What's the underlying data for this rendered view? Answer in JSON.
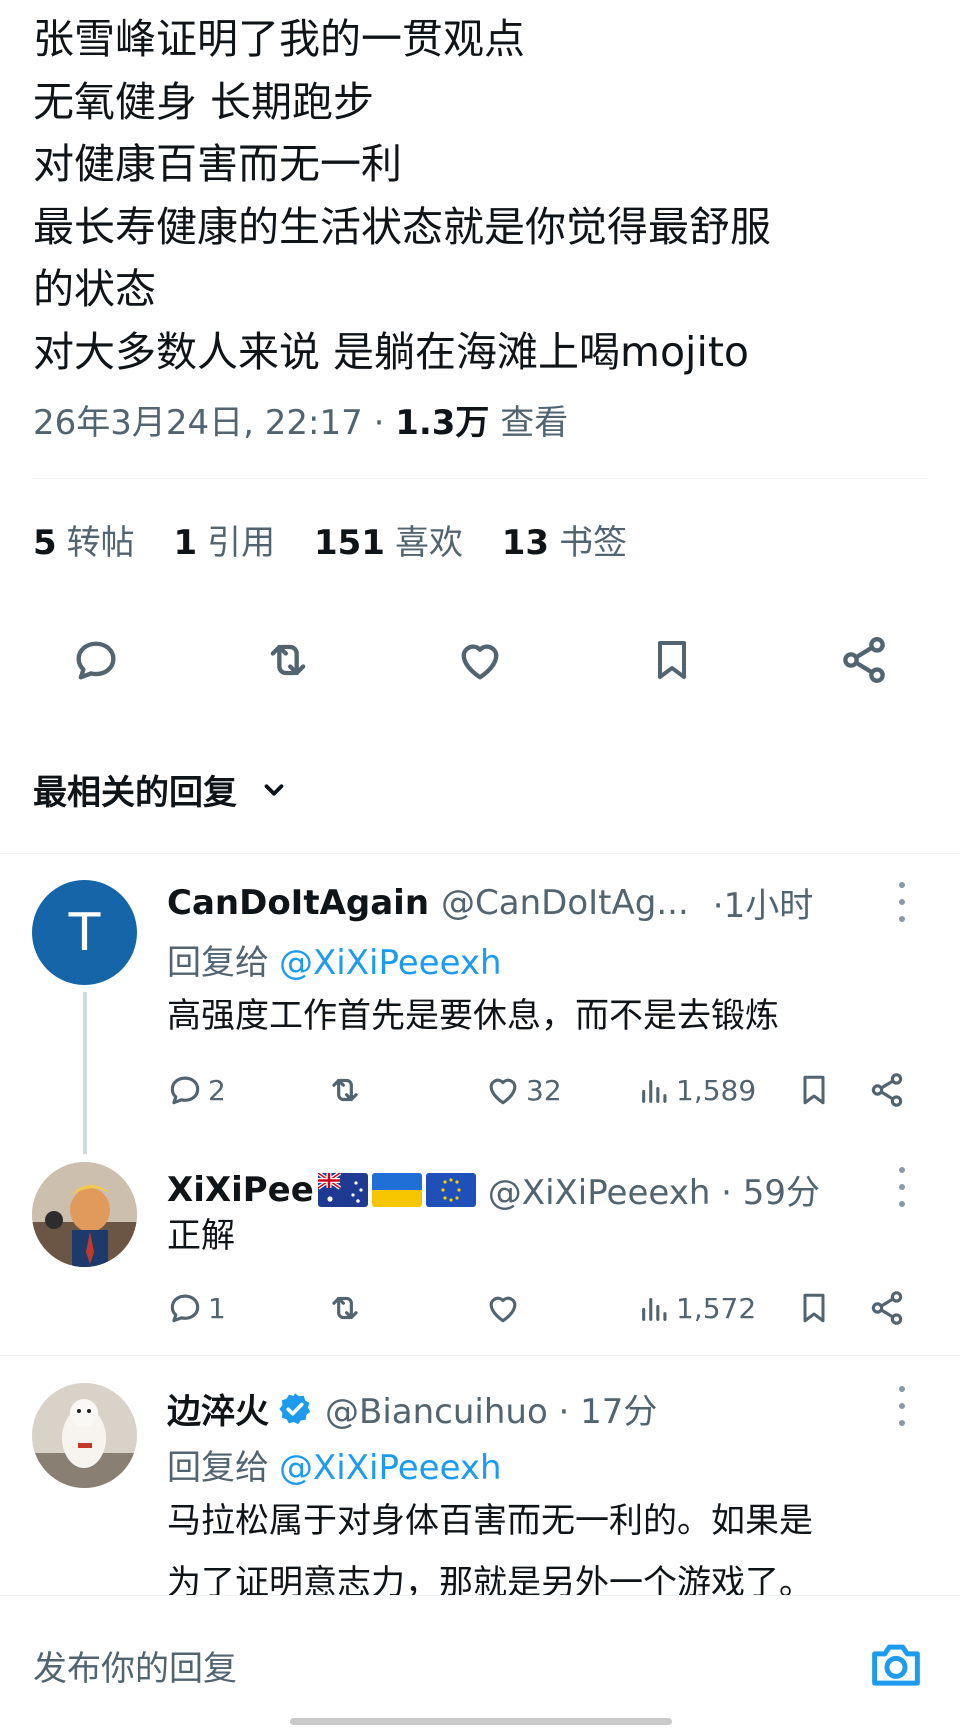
{
  "tweet": {
    "lines": [
      "张雪峰证明了我的一贯观点",
      "无氧健身 长期跑步",
      "对健康百害而无一利",
      "最长寿健康的生活状态就是你觉得最舒服",
      "的状态",
      "对大多数人来说 是躺在海滩上喝mojito"
    ],
    "timestamp": "26年3月24日, 22:17 ·",
    "views_count": "1.3万",
    "views_label": "查看"
  },
  "stats": [
    {
      "count": "5",
      "label": "转帖"
    },
    {
      "count": "1",
      "label": "引用"
    },
    {
      "count": "151",
      "label": "喜欢"
    },
    {
      "count": "13",
      "label": "书签"
    }
  ],
  "actions": {
    "icons": [
      "reply-icon",
      "repost-icon",
      "like-icon",
      "bookmark-icon",
      "share-icon"
    ]
  },
  "sort": {
    "label": "最相关的回复",
    "icon": "chevron-down-icon"
  },
  "replies": [
    {
      "name": "CanDoItAgain",
      "handle": "@CanDoItAg...",
      "time": "·1小时",
      "reply_to_label": "回复给",
      "reply_to_handle": "@XiXiPeeexh",
      "avatar_letter": "T",
      "avatar_color": "#1565a8",
      "body": [
        "高强度工作首先是要休息，而不是去锻炼"
      ],
      "replies": "2",
      "reposts": "",
      "likes": "32",
      "views": "1,589"
    },
    {
      "name": "XiXiPee",
      "handle": "@XiXiPeeexh · 59分",
      "flags": [
        "australia-flag",
        "ukraine-flag",
        "eu-flag"
      ],
      "body": [
        "正解"
      ],
      "replies": "1",
      "reposts": "",
      "likes": "",
      "views": "1,572"
    },
    {
      "name": "边淬火",
      "handle": "@Biancuihuo · 17分",
      "verified": true,
      "reply_to_label": "回复给",
      "reply_to_handle": "@XiXiPeeexh",
      "body": [
        "马拉松属于对身体百害而无一利的。如果是",
        "为了证明意志力，那就是另外一个游戏了。"
      ]
    }
  ],
  "composer": {
    "placeholder": "发布你的回复",
    "icon": "camera-icon"
  },
  "colors": {
    "text": "#0f1419",
    "secondary": "#536471",
    "accent": "#1d9bf0",
    "divider": "#eff3f4"
  }
}
